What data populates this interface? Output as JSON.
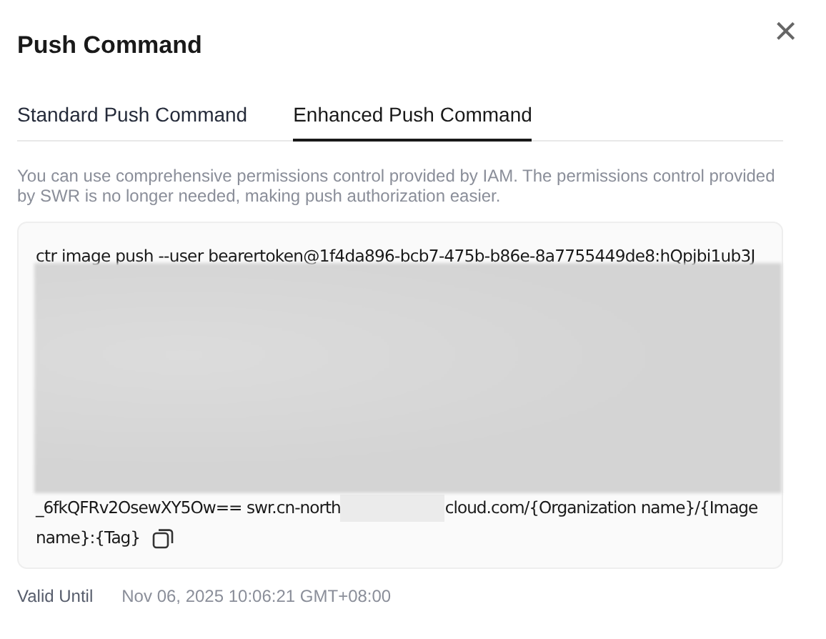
{
  "dialog": {
    "title": "Push Command",
    "close": "×"
  },
  "tabs": [
    {
      "label": "Standard Push Command",
      "selected": false
    },
    {
      "label": "Enhanced Push Command",
      "selected": true
    }
  ],
  "notice": "You can use comprehensive permissions control provided by IAM. The permissions control provided by SWR is no longer needed, making push authorization easier.",
  "command": {
    "line_1": "ctr image push --user bearertoken@1f4da896-bcb7-475b-b86e-8a7755449de8:hQpjbi1ub3J",
    "text_before_redaction": "_6fkQFRv2OsewXY5Ow== swr.cn-north",
    "text_after_redaction": "cloud.com/{Organization name}/{Image",
    "line_3": "name}:{Tag}"
  },
  "valid_until": {
    "label": "Valid Until",
    "value": "Nov 06, 2025 10:06:21 GMT+08:00"
  }
}
